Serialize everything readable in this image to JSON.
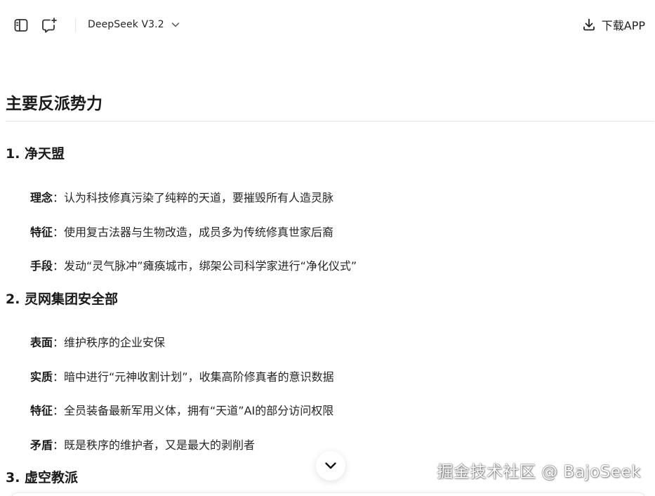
{
  "topbar": {
    "model_name": "DeepSeek V3.2",
    "download_label": "下载APP"
  },
  "content": {
    "section_title": "主要反派势力",
    "factions": [
      {
        "title": "1. 净天盟",
        "items": [
          {
            "key": "理念",
            "text": "：认为科技修真污染了纯粹的天道，要摧毁所有人造灵脉"
          },
          {
            "key": "特征",
            "text": "：使用复古法器与生物改造，成员多为传统修真世家后裔"
          },
          {
            "key": "手段",
            "text": "：发动“灵气脉冲”瘫痪城市，绑架公司科学家进行“净化仪式”"
          }
        ]
      },
      {
        "title": "2. 灵网集团安全部",
        "items": [
          {
            "key": "表面",
            "text": "：维护秩序的企业安保"
          },
          {
            "key": "实质",
            "text": "：暗中进行“元神收割计划”，收集高阶修真者的意识数据"
          },
          {
            "key": "特征",
            "text": "：全员装备最新军用义体，拥有“天道”AI的部分访问权限"
          },
          {
            "key": "矛盾",
            "text": "：既是秩序的维护者，又是最大的剥削者"
          }
        ]
      },
      {
        "title": "3. 虚空教派",
        "items": []
      }
    ]
  },
  "watermark": "掘金技术社区 @ BajoSeek",
  "colors": {
    "text": "#1f1f1f",
    "divider": "#e5e5e5",
    "background": "#ffffff"
  },
  "icons": {
    "sidebar_toggle": "sidebar-toggle-icon",
    "new_chat": "new-chat-icon",
    "model_dropdown": "chevron-down-icon",
    "download": "download-icon",
    "scroll_down": "chevron-down-icon"
  }
}
